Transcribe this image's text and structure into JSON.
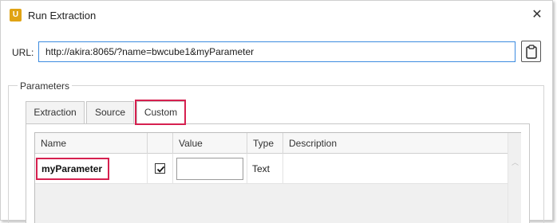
{
  "window": {
    "title": "Run Extraction",
    "app_icon_letter": "U",
    "close_glyph": "✕"
  },
  "url": {
    "label": "URL:",
    "value": "http://akira:8065/?name=bwcube1&myParameter",
    "clipboard_icon": "clipboard-icon"
  },
  "parameters": {
    "group_label": "Parameters",
    "tabs": [
      {
        "label": "Extraction",
        "active": false
      },
      {
        "label": "Source",
        "active": false
      },
      {
        "label": "Custom",
        "active": true
      }
    ],
    "grid": {
      "columns": [
        "Name",
        "",
        "Value",
        "Type",
        "Description"
      ],
      "rows": [
        {
          "name": "myParameter",
          "checked": true,
          "value": "",
          "type": "Text",
          "description": ""
        }
      ]
    }
  },
  "colors": {
    "accent_focus": "#3d8be0",
    "highlight": "#d6204f",
    "app_icon": "#e0a314"
  }
}
